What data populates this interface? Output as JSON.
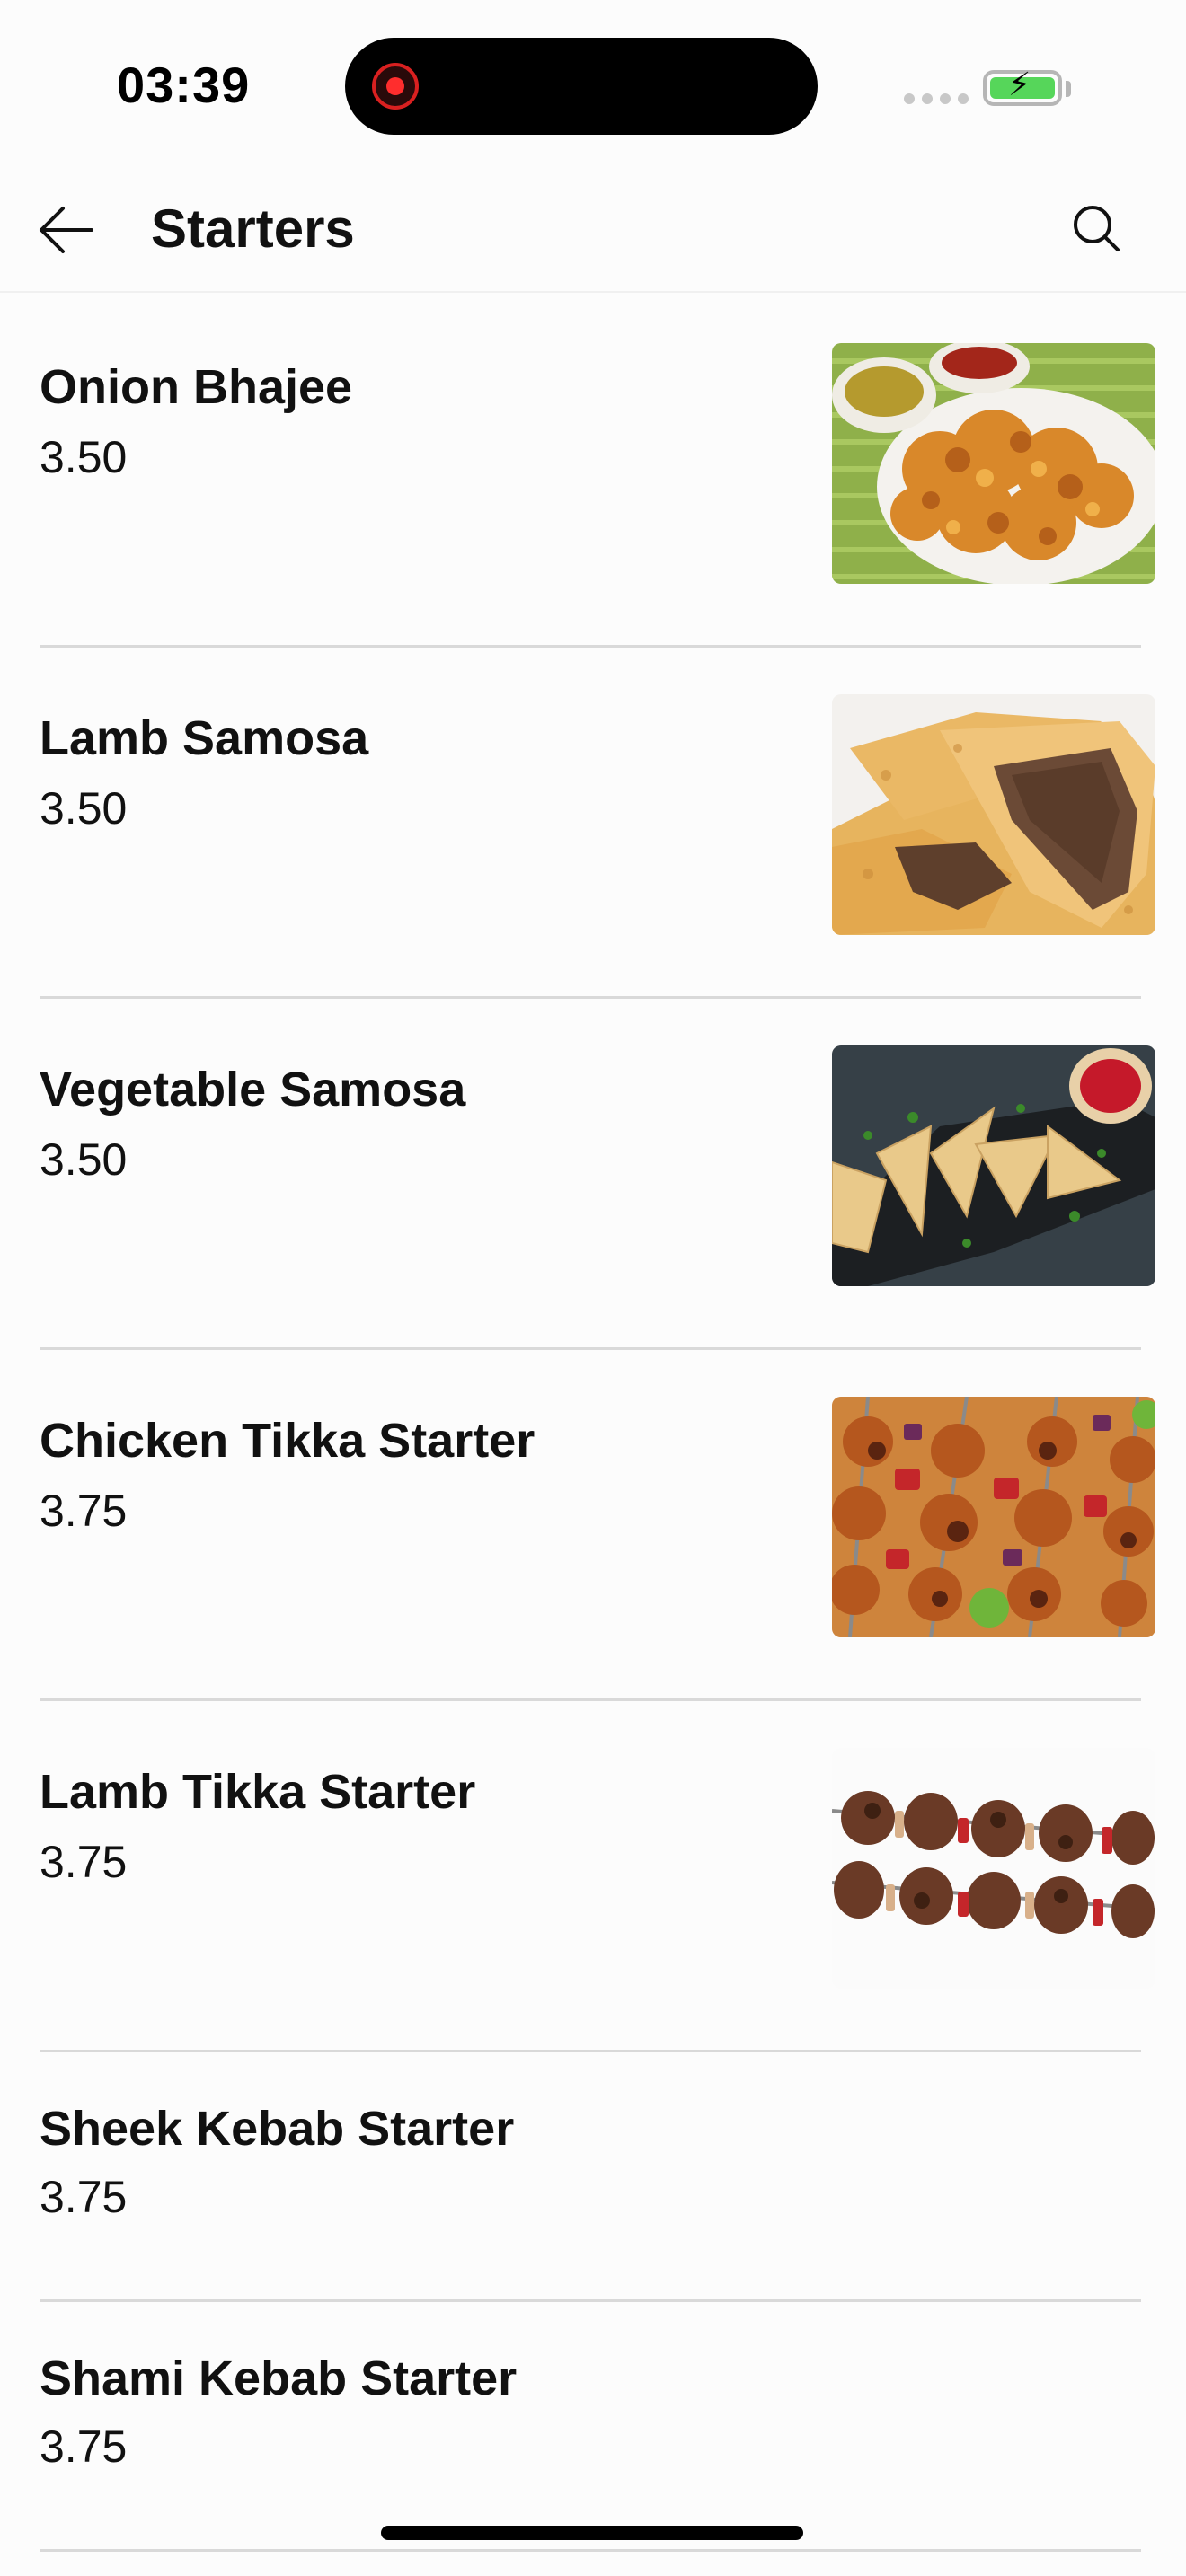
{
  "status_bar": {
    "time": "03:39"
  },
  "header": {
    "title": "Starters",
    "back_icon": "arrow-left-icon",
    "search_icon": "search-icon"
  },
  "items": [
    {
      "name": "Onion Bhajee",
      "price": "3.50",
      "image": "onion-bhajee-photo"
    },
    {
      "name": "Lamb Samosa",
      "price": "3.50",
      "image": "lamb-samosa-photo"
    },
    {
      "name": "Vegetable Samosa",
      "price": "3.50",
      "image": "vegetable-samosa-photo"
    },
    {
      "name": "Chicken Tikka Starter",
      "price": "3.75",
      "image": "chicken-tikka-photo"
    },
    {
      "name": "Lamb Tikka Starter",
      "price": "3.75",
      "image": "lamb-tikka-photo"
    },
    {
      "name": "Sheek Kebab Starter",
      "price": "3.75"
    },
    {
      "name": "Shami Kebab Starter",
      "price": "3.75"
    }
  ],
  "colors": {
    "background": "#fcfcfc",
    "divider": "#d9d9d9",
    "battery": "#56d65a",
    "record": "#ff2d2d"
  }
}
